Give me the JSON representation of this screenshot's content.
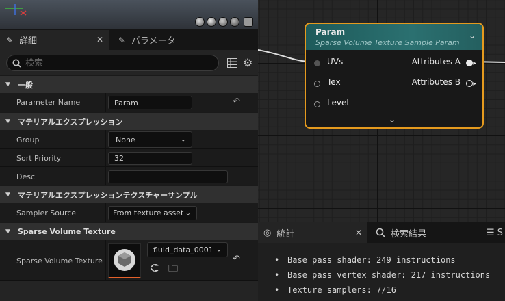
{
  "details_panel": {
    "tab_details": "詳細",
    "tab_parameters": "パラメータ",
    "search_placeholder": "検索",
    "sections": {
      "general": "一般",
      "material_expression": "マテリアルエクスプレッション",
      "texture_sample": "マテリアルエクスプレッションテクスチャーサンプル",
      "svt": "Sparse Volume Texture"
    },
    "rows": {
      "parameter_name": {
        "label": "Parameter Name",
        "value": "Param"
      },
      "group": {
        "label": "Group",
        "value": "None"
      },
      "sort_priority": {
        "label": "Sort Priority",
        "value": "32"
      },
      "desc": {
        "label": "Desc",
        "value": ""
      },
      "sampler_source": {
        "label": "Sampler Source",
        "value": "From texture asset"
      },
      "sparse_volume_texture": {
        "label": "Sparse Volume Texture",
        "value": "fluid_data_0001"
      }
    }
  },
  "node": {
    "title": "Param",
    "subtitle": "Sparse Volume Texture Sample Param",
    "inputs": [
      "UVs",
      "Tex",
      "Level"
    ],
    "outputs": [
      "Attributes A",
      "Attributes B"
    ],
    "border_color": "#e59a1e",
    "header_color": "#2b7070"
  },
  "stats_panel": {
    "tab_stats": "統計",
    "tab_search_results": "検索結果",
    "lines": [
      "Base pass shader: 249 instructions",
      "Base pass vertex shader: 217 instructions",
      "Texture samplers: 7/16"
    ]
  }
}
